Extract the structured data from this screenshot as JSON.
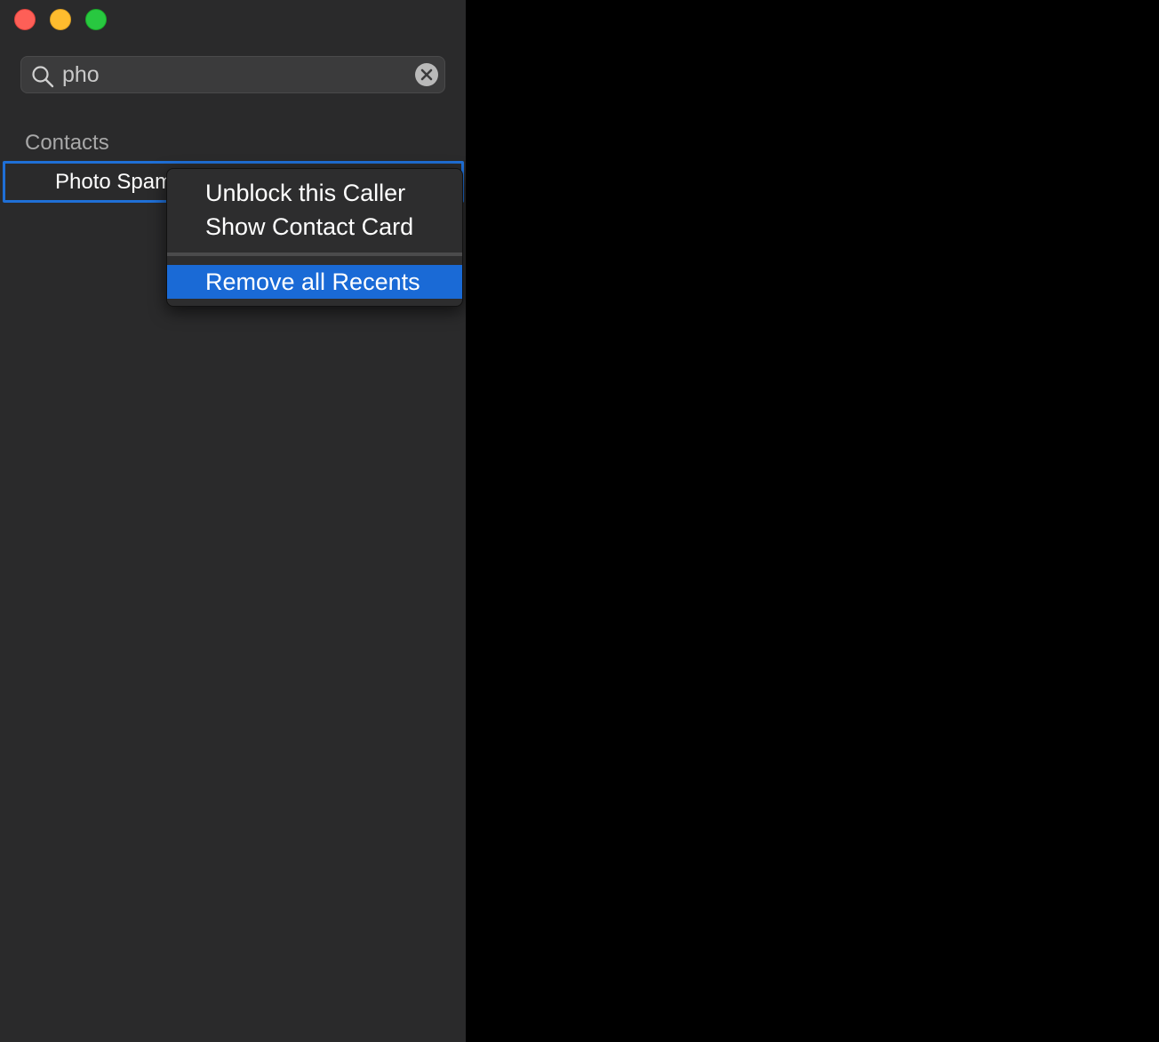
{
  "window": {
    "controls": [
      "close",
      "minimize",
      "zoom"
    ],
    "accent_color": "#1a6ad6"
  },
  "search": {
    "value": "pho",
    "icon": "magnifying-glass-icon",
    "clear_icon": "clear-circle-x-icon"
  },
  "sidebar": {
    "section_header": "Contacts",
    "contacts": [
      {
        "name": "Photo Spam"
      }
    ]
  },
  "context_menu": {
    "items": [
      {
        "label": "Unblock this Caller",
        "highlighted": false
      },
      {
        "label": "Show Contact Card",
        "highlighted": false
      },
      {
        "label": "Remove all Recents",
        "highlighted": true
      }
    ]
  }
}
